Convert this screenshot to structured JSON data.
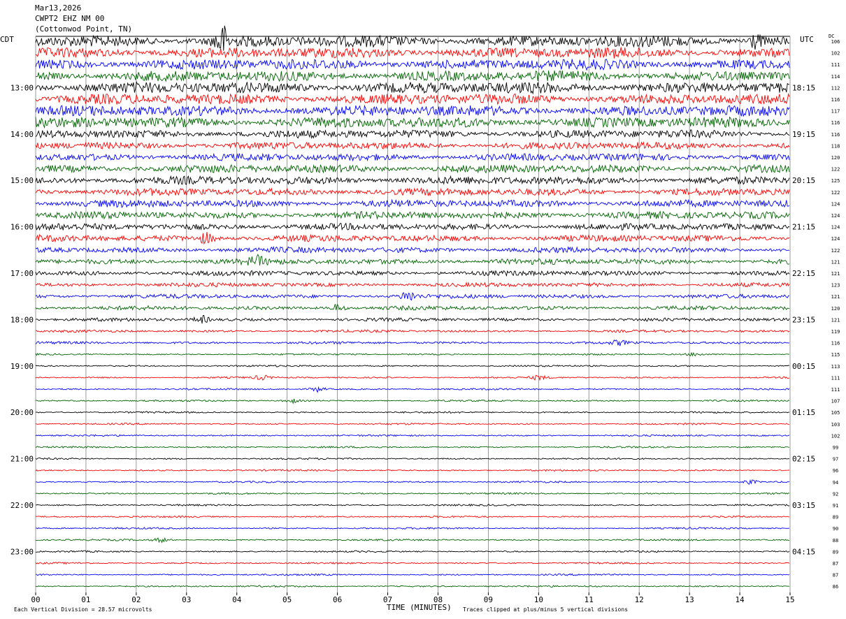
{
  "header": {
    "date": "Mar13,2026",
    "station": "CWPT2 EHZ NM 00",
    "location": "(Cottonwod Point, TN)"
  },
  "left_zone_label": "CDT",
  "right_zone_label": "UTC",
  "dc_label": "DC",
  "footer": {
    "scale_note": "Each Vertical Division =   28.57 microvolts",
    "axis_title": "TIME (MINUTES)",
    "clip_note": "Traces clipped at plus/minus 5 vertical divisions"
  },
  "colors": {
    "trace_cycle": [
      "#000000",
      "#ff0000",
      "#0000ff",
      "#006400"
    ],
    "grid": "#808080"
  },
  "chart_data": {
    "type": "seismogram",
    "xlabel": "TIME (MINUTES)",
    "xlim": [
      0,
      15
    ],
    "x_ticks": [
      "00",
      "01",
      "02",
      "03",
      "04",
      "05",
      "06",
      "07",
      "08",
      "09",
      "10",
      "11",
      "12",
      "13",
      "14",
      "15"
    ],
    "trace_minutes": 15,
    "trace_count": 48,
    "left_hour_labels": [
      "13:00",
      "14:00",
      "15:00",
      "16:00",
      "17:00",
      "18:00",
      "19:00",
      "20:00",
      "21:00",
      "22:00",
      "23:00"
    ],
    "right_hour_labels": [
      "18:15",
      "19:15",
      "20:15",
      "21:15",
      "22:15",
      "23:15",
      "00:15",
      "01:15",
      "02:15",
      "03:15",
      "04:15"
    ],
    "hour_label_first_trace": 4,
    "dc_offsets": [
      "106",
      "102",
      "111",
      "114",
      "112",
      "116",
      "117",
      "116",
      "116",
      "118",
      "120",
      "122",
      "125",
      "122",
      "124",
      "124",
      "124",
      "124",
      "122",
      "121",
      "121",
      "123",
      "121",
      "120",
      "121",
      "119",
      "116",
      "115",
      "113",
      "111",
      "111",
      "107",
      "105",
      "103",
      "102",
      "99",
      "97",
      "96",
      "94",
      "92",
      "91",
      "89",
      "90",
      "88",
      "89",
      "87",
      "87",
      "86"
    ],
    "trace_amplitude": [
      14,
      13,
      13,
      13,
      14,
      13,
      13,
      13,
      10,
      9,
      9,
      10,
      10,
      9,
      9,
      9,
      8,
      8,
      7,
      7,
      6,
      5,
      5,
      5,
      4,
      3,
      3,
      2,
      2,
      2,
      2,
      2,
      2,
      2,
      2,
      2,
      2,
      2,
      2,
      2,
      2,
      2,
      2,
      2,
      2,
      2,
      2,
      2
    ],
    "events": [
      {
        "trace": 0,
        "minute": 3.7,
        "amp": 40
      },
      {
        "trace": 0,
        "minute": 14.3,
        "amp": 18
      },
      {
        "trace": 17,
        "minute": 3.4,
        "amp": 14
      },
      {
        "trace": 19,
        "minute": 4.4,
        "amp": 12
      },
      {
        "trace": 22,
        "minute": 7.4,
        "amp": 14
      },
      {
        "trace": 23,
        "minute": 6.0,
        "amp": 10
      },
      {
        "trace": 24,
        "minute": 3.3,
        "amp": 10
      },
      {
        "trace": 26,
        "minute": 11.6,
        "amp": 6
      },
      {
        "trace": 27,
        "minute": 13.1,
        "amp": 4
      },
      {
        "trace": 29,
        "minute": 4.5,
        "amp": 6
      },
      {
        "trace": 29,
        "minute": 10.0,
        "amp": 6
      },
      {
        "trace": 30,
        "minute": 5.6,
        "amp": 7
      },
      {
        "trace": 31,
        "minute": 5.1,
        "amp": 6
      },
      {
        "trace": 38,
        "minute": 14.2,
        "amp": 6
      },
      {
        "trace": 43,
        "minute": 2.5,
        "amp": 6
      }
    ]
  }
}
